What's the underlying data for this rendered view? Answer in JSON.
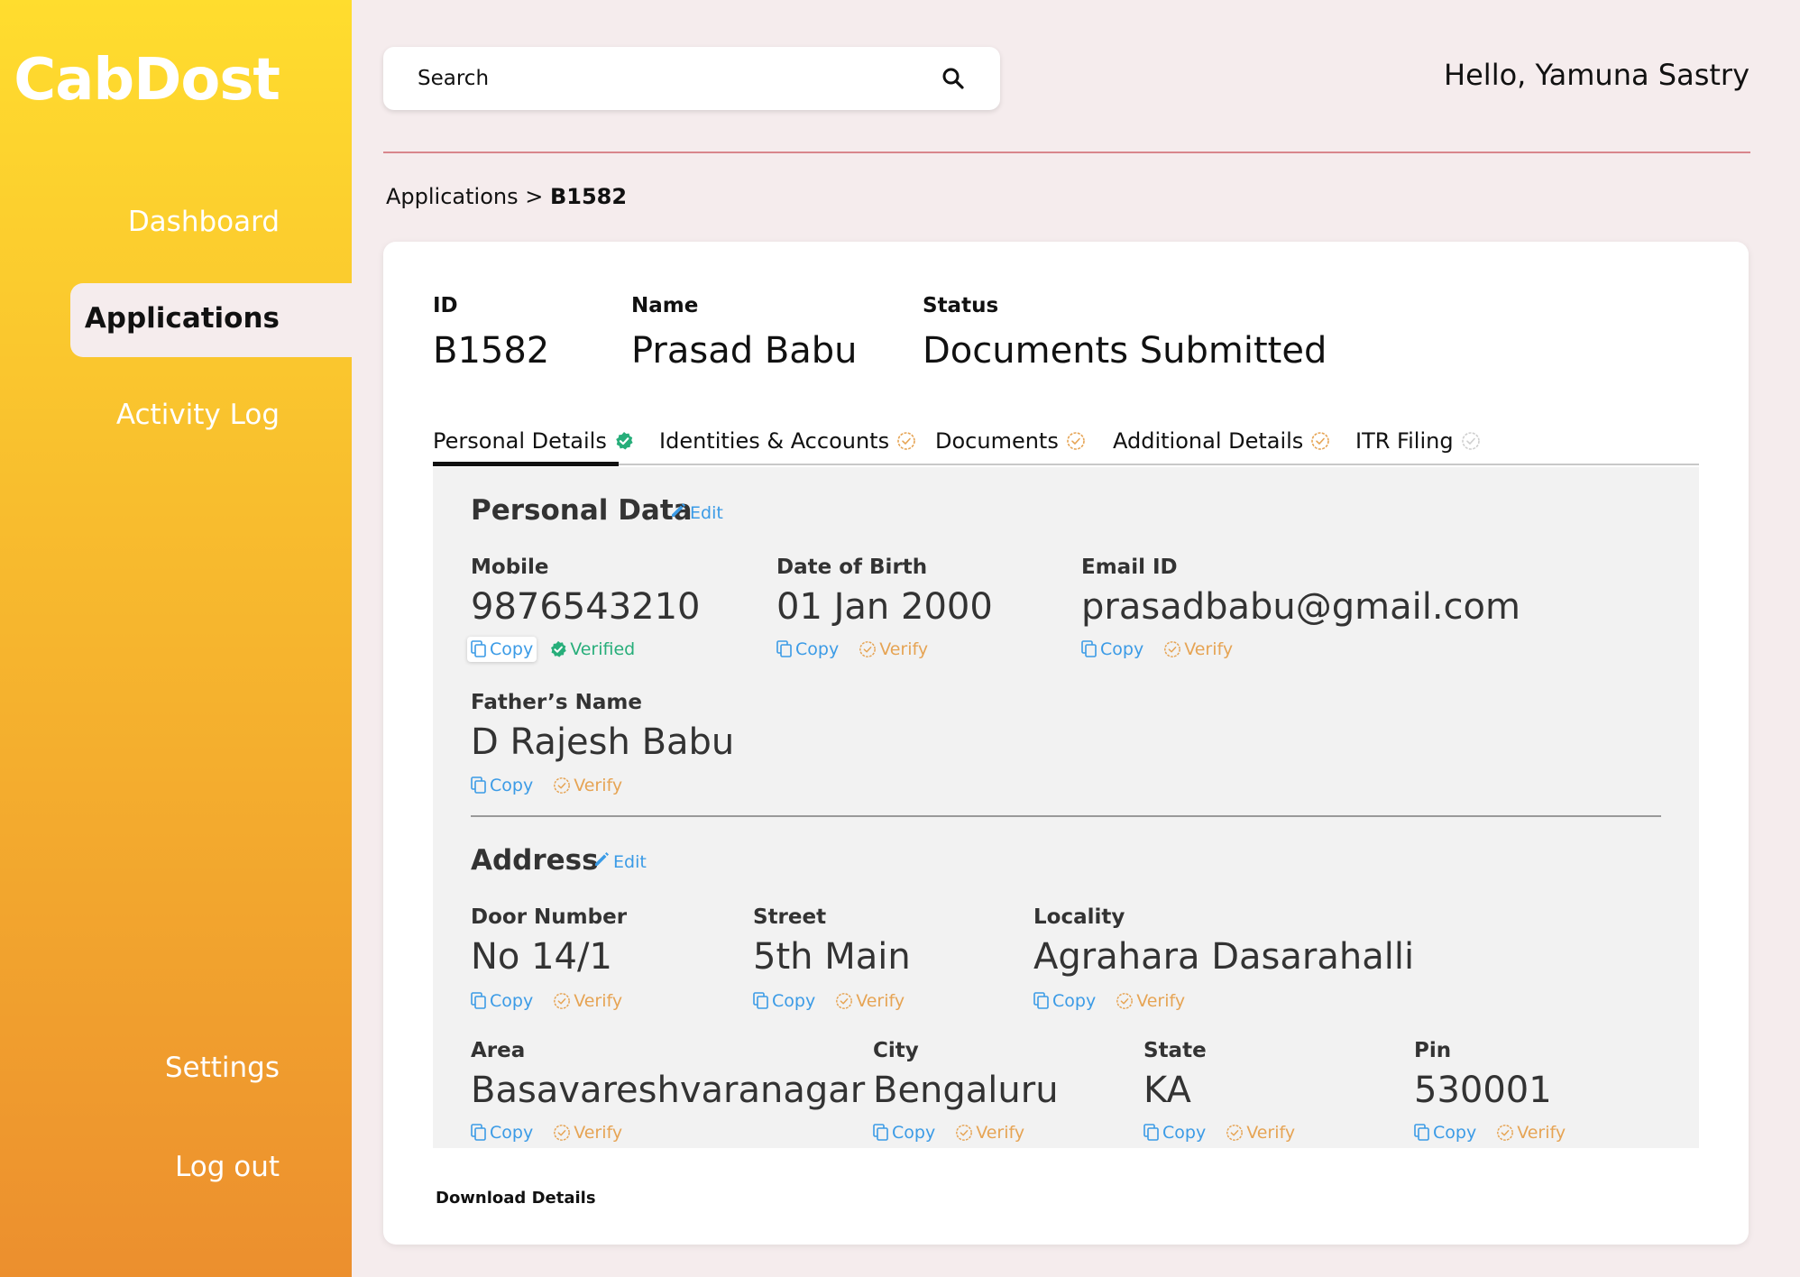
{
  "app": {
    "logo": "CabDost"
  },
  "sidebar": {
    "items": [
      {
        "label": "Dashboard"
      },
      {
        "label": "Applications"
      },
      {
        "label": "Activity Log"
      }
    ],
    "bottom_items": [
      {
        "label": "Settings"
      },
      {
        "label": "Log out"
      }
    ]
  },
  "header": {
    "search_placeholder": "Search",
    "greeting": "Hello, Yamuna Sastry"
  },
  "breadcrumb": {
    "parent": "Applications",
    "separator": " > ",
    "current": "B1582"
  },
  "summary": {
    "id_label": "ID",
    "id_value": "B1582",
    "name_label": "Name",
    "name_value": "Prasad Babu",
    "status_label": "Status",
    "status_value": "Documents Submitted"
  },
  "tabs": [
    {
      "label": "Personal Details",
      "state": "complete"
    },
    {
      "label": "Identities & Accounts",
      "state": "pending"
    },
    {
      "label": "Documents",
      "state": "pending"
    },
    {
      "label": "Additional Details",
      "state": "pending"
    },
    {
      "label": "ITR Filing",
      "state": "disabled"
    }
  ],
  "actions": {
    "copy": "Copy",
    "verify": "Verify",
    "verified": "Verified",
    "edit": "Edit"
  },
  "personal_data": {
    "title": "Personal Data",
    "fields": [
      {
        "label": "Mobile",
        "value": "9876543210",
        "status": "verified"
      },
      {
        "label": "Date of Birth",
        "value": "01 Jan 2000",
        "status": "unverified"
      },
      {
        "label": "Email ID",
        "value": "prasadbabu@gmail.com",
        "status": "unverified"
      },
      {
        "label": "Father’s Name",
        "value": "D Rajesh Babu",
        "status": "unverified"
      }
    ]
  },
  "address": {
    "title": "Address",
    "fields": [
      {
        "label": "Door Number",
        "value": "No 14/1"
      },
      {
        "label": "Street",
        "value": "5th Main"
      },
      {
        "label": "Locality",
        "value": "Agrahara Dasarahalli"
      },
      {
        "label": "Area",
        "value": "Basavareshvaranagar"
      },
      {
        "label": "City",
        "value": "Bengaluru"
      },
      {
        "label": "State",
        "value": "KA"
      },
      {
        "label": "Pin",
        "value": "530001"
      }
    ]
  },
  "footer": {
    "download_label": "Download Details"
  },
  "colors": {
    "sidebar_top": "#ffdd2e",
    "sidebar_bottom": "#ec8f2e",
    "background": "#f5eced",
    "link_blue": "#3b9be6",
    "verify_orange": "#e6a454",
    "verified_green": "#27ae7a",
    "divider_red": "#d9868c"
  }
}
